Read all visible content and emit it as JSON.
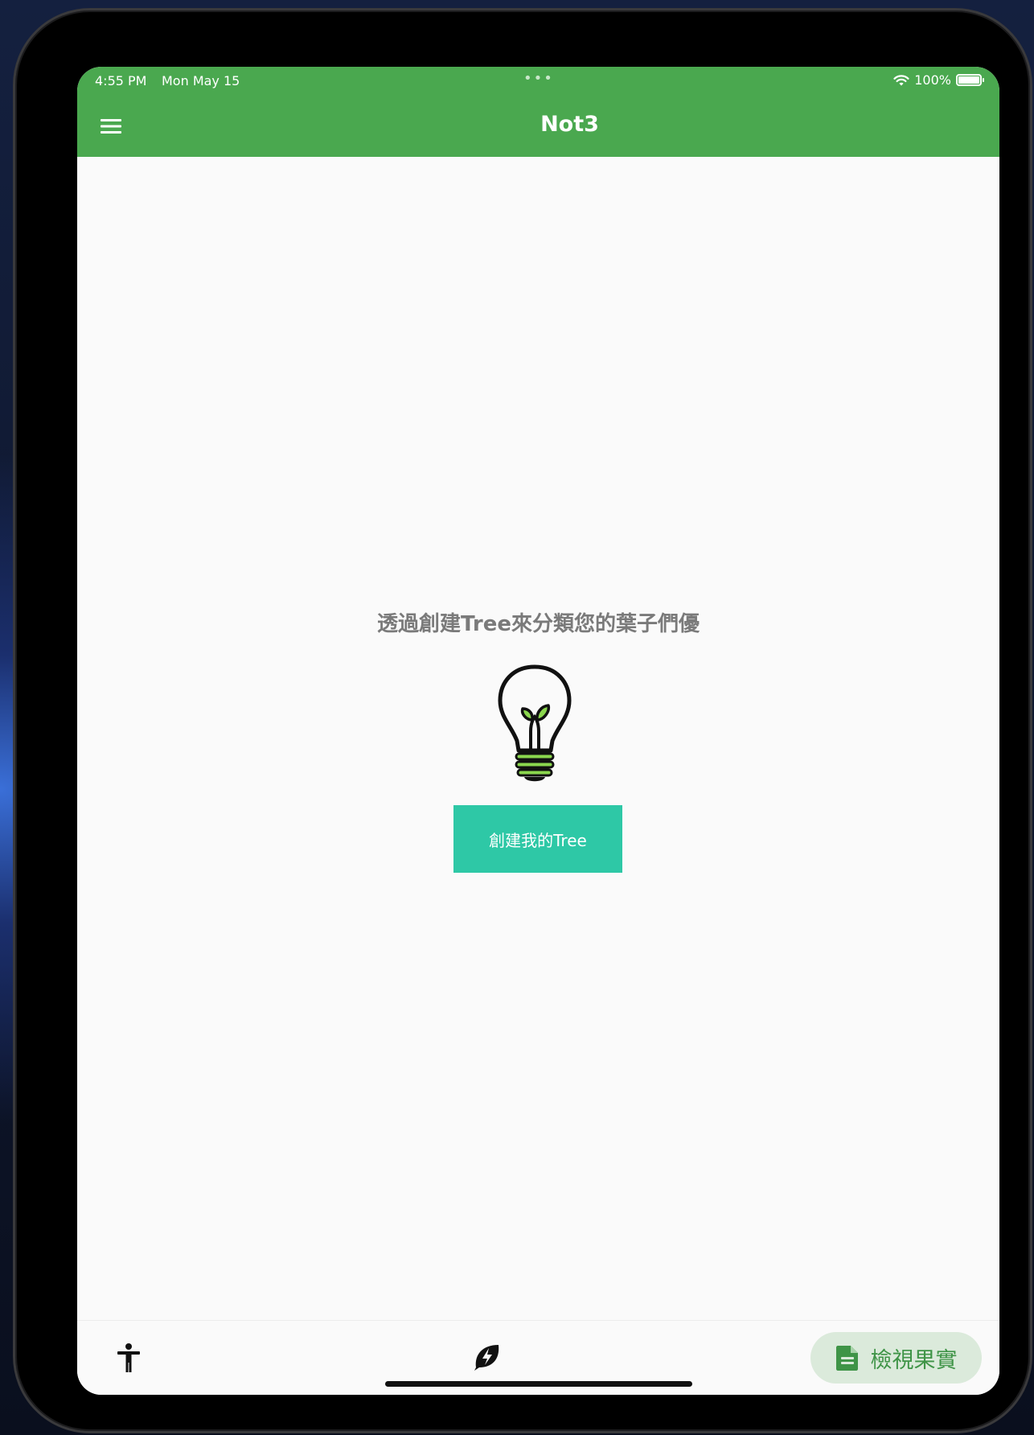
{
  "status_bar": {
    "time": "4:55 PM",
    "date": "Mon May 15",
    "dots": "•••",
    "battery": "100%"
  },
  "app_bar": {
    "title": "Not3",
    "menu_icon": "hamburger-menu-icon",
    "color": "#4aa84f"
  },
  "content": {
    "empty_message": "透過創建Tree來分類您的葉子們優",
    "illustration_icon": "lightbulb-sprout-icon",
    "create_button_label": "創建我的Tree",
    "create_button_color": "#2ec8a6"
  },
  "bottom_bar": {
    "accessibility_icon": "accessibility-icon",
    "leaf_icon": "leaf-bolt-icon",
    "view_fruit_label": "檢視果實",
    "view_fruit_icon": "document-icon",
    "view_fruit_color": "#3f9447"
  }
}
